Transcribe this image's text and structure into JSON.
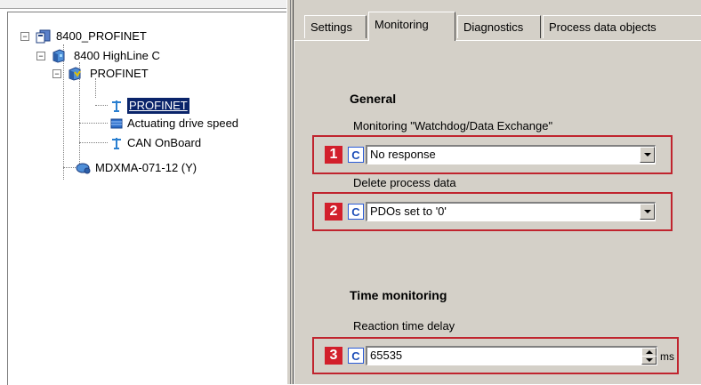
{
  "tree": {
    "nodes": [
      {
        "label": "8400_PROFINET",
        "icon": "project-icon",
        "expander": "−"
      },
      {
        "label": "8400 HighLine C",
        "icon": "controller-device-icon",
        "expander": "−"
      },
      {
        "label": "PROFINET",
        "icon": "fieldbus-module-icon",
        "expander": "−"
      },
      {
        "label": "PROFINET",
        "icon": "network-antenna-icon",
        "selected": true
      },
      {
        "label": "Actuating drive speed",
        "icon": "application-block-icon"
      },
      {
        "label": "CAN OnBoard",
        "icon": "network-antenna-icon"
      },
      {
        "label": "MDXMA-071-12 (Y)",
        "icon": "motor-icon"
      }
    ]
  },
  "tabs": [
    {
      "label": "Settings"
    },
    {
      "label": "Monitoring",
      "active": true
    },
    {
      "label": "Diagnostics"
    },
    {
      "label": "Process data objects"
    }
  ],
  "monitoring": {
    "general_heading": "General",
    "watchdog": {
      "caption": "Monitoring \"Watchdog/Data Exchange\"",
      "badge": "1",
      "code": "C",
      "value": "No response"
    },
    "delete_pd": {
      "caption": "Delete process data",
      "badge": "2",
      "code": "C",
      "value": "PDOs set to '0'"
    },
    "time_heading": "Time monitoring",
    "reaction": {
      "caption": "Reaction time delay",
      "badge": "3",
      "code": "C",
      "value": "65535",
      "unit": "ms"
    }
  },
  "colors": {
    "highlight_red": "#c0242e",
    "badge_red": "#d21f2b",
    "code_blue": "#1f4fb8",
    "selection_navy": "#0a246a",
    "dialog_gray": "#d4d0c8"
  }
}
